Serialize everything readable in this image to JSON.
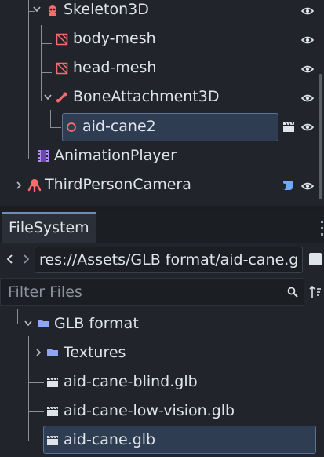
{
  "scene_tree": {
    "nodes": [
      {
        "label": "Skeleton3D",
        "icon": "skeleton-icon",
        "visible_eye": true
      },
      {
        "label": "body-mesh",
        "icon": "mesh-instance-icon",
        "visible_eye": true
      },
      {
        "label": "head-mesh",
        "icon": "mesh-instance-icon",
        "visible_eye": true
      },
      {
        "label": "BoneAttachment3D",
        "icon": "bone-attachment-icon",
        "visible_eye": true
      },
      {
        "label": "aid-cane2",
        "icon": "node3d-circle-icon",
        "visible_eye": true,
        "selected": true
      },
      {
        "label": "AnimationPlayer",
        "icon": "animation-player-icon",
        "visible_eye": false
      },
      {
        "label": "ThirdPersonCamera",
        "icon": "camera-rig-icon",
        "visible_eye": true
      }
    ]
  },
  "filesystem": {
    "tab_label": "FileSystem",
    "path": "res://Assets/GLB format/aid-cane.g",
    "filter_placeholder": "Filter Files",
    "items": [
      {
        "label": "GLB format",
        "icon": "folder-icon"
      },
      {
        "label": "Textures",
        "icon": "folder-icon"
      },
      {
        "label": "aid-cane-blind.glb",
        "icon": "scene-file-icon"
      },
      {
        "label": "aid-cane-low-vision.glb",
        "icon": "scene-file-icon"
      },
      {
        "label": "aid-cane.glb",
        "icon": "scene-file-icon",
        "selected": true
      }
    ]
  },
  "colors": {
    "background": "#21252b",
    "accent": "#6f8dbb",
    "selection": "#2e3d52",
    "node_red": "#ff5f5f",
    "folder_blue": "#8da5f3"
  }
}
